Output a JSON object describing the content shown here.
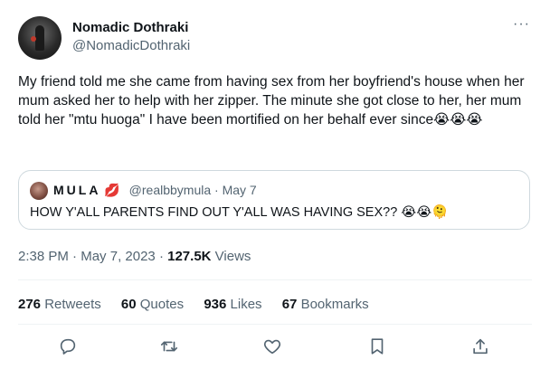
{
  "author": {
    "display_name": "Nomadic Dothraki",
    "handle": "@NomadicDothraki"
  },
  "more_icon": "more-horizontal-icon",
  "tweet": {
    "text": "My friend told me she came from having sex from her boyfriend's house when her mum asked her to help with her zipper. The minute she got close to her, her mum told her \"mtu huoga\" I have been mortified  on her behalf ever since😭😭😭"
  },
  "quote": {
    "name": "MULA",
    "name_emoji": "💋",
    "handle": "@realbbymula",
    "separator": "·",
    "date": "May 7",
    "text": "HOW Y'ALL PARENTS FIND OUT Y'ALL WAS HAVING SEX?? 😭😭🫠"
  },
  "meta": {
    "time": "2:38 PM",
    "separator": "·",
    "date": "May 7, 2023",
    "views_count": "127.5K",
    "views_label": "Views"
  },
  "stats": {
    "retweets_count": "276",
    "retweets_label": "Retweets",
    "quotes_count": "60",
    "quotes_label": "Quotes",
    "likes_count": "936",
    "likes_label": "Likes",
    "bookmarks_count": "67",
    "bookmarks_label": "Bookmarks"
  },
  "actions": [
    "reply-icon",
    "retweet-icon",
    "like-icon",
    "bookmark-icon",
    "share-icon"
  ],
  "colors": {
    "text_primary": "#0f1419",
    "text_secondary": "#536471",
    "border": "#cfd9de"
  }
}
